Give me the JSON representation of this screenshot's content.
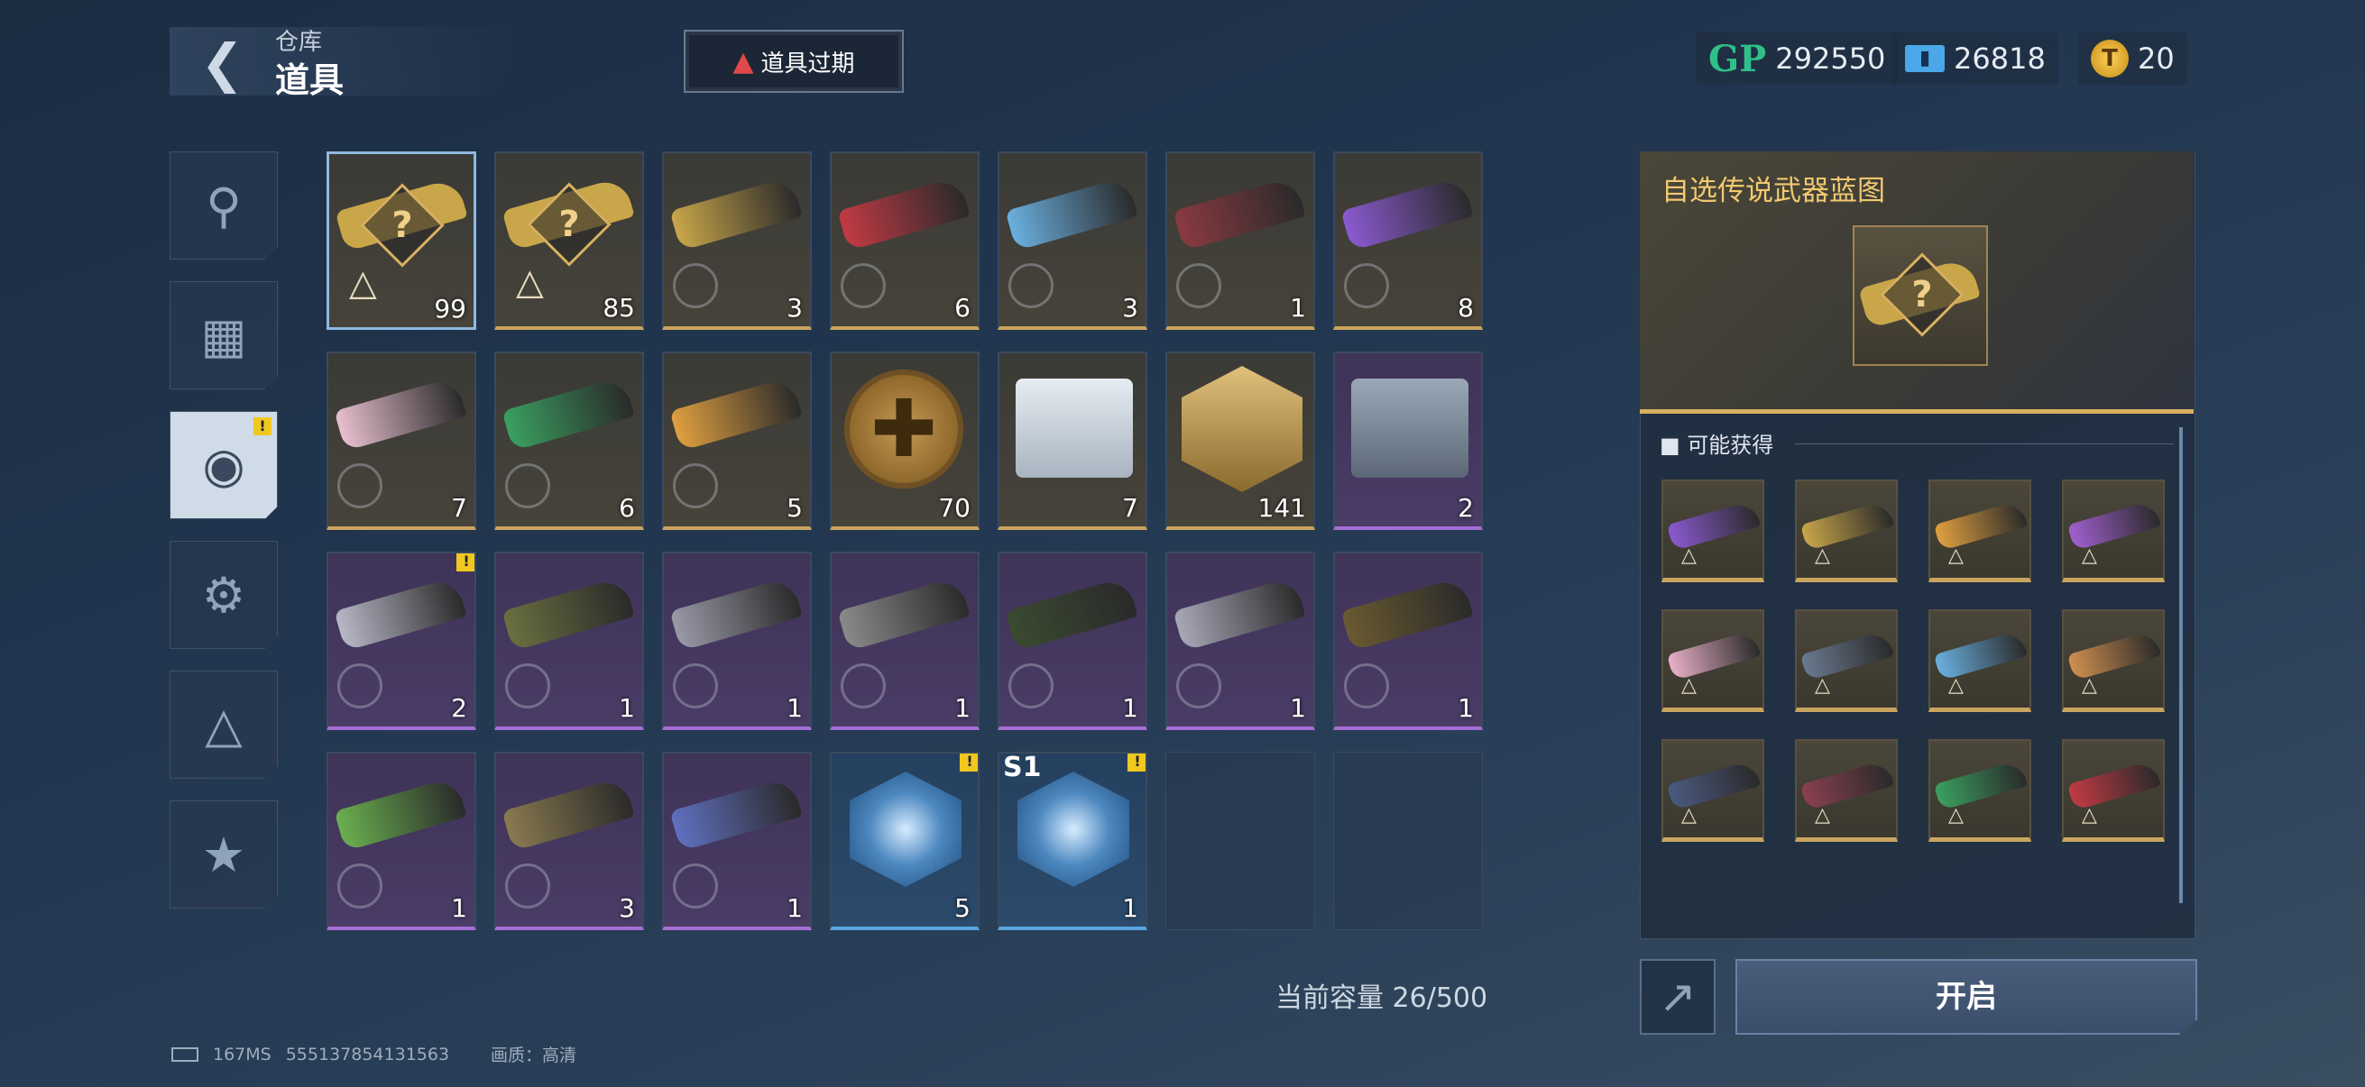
{
  "header": {
    "breadcrumb": "仓库",
    "title": "道具",
    "expired_button": "道具过期"
  },
  "currencies": [
    {
      "icon": "gp-icon",
      "label": "GP",
      "value": "292550"
    },
    {
      "icon": "ticket-icon",
      "value": "26818"
    },
    {
      "icon": "coin-icon",
      "value": "20"
    }
  ],
  "side_tabs": [
    {
      "icon": "pistol-icon"
    },
    {
      "icon": "scroll-icon"
    },
    {
      "icon": "grenade-icon",
      "active": true,
      "badge": "!"
    },
    {
      "icon": "gear-swap-icon"
    },
    {
      "icon": "blueprint-icon"
    },
    {
      "icon": "star-icon"
    }
  ],
  "items": [
    {
      "kind": "blueprint",
      "rarity": "gold",
      "count": "99"
    },
    {
      "kind": "blueprint",
      "rarity": "gold",
      "count": "85"
    },
    {
      "kind": "weapon",
      "rarity": "gold",
      "count": "3",
      "color": "#c9a64a"
    },
    {
      "kind": "weapon",
      "rarity": "gold",
      "count": "6",
      "color": "#c23a44"
    },
    {
      "kind": "weapon",
      "rarity": "gold",
      "count": "3",
      "color": "#6ab0e0"
    },
    {
      "kind": "weapon",
      "rarity": "gold",
      "count": "1",
      "color": "#8a3a40"
    },
    {
      "kind": "weapon",
      "rarity": "gold",
      "count": "8",
      "color": "#8a5ad0"
    },
    {
      "kind": "weapon",
      "rarity": "gold",
      "count": "7",
      "color": "#e8c0d0"
    },
    {
      "kind": "weapon",
      "rarity": "gold",
      "count": "6",
      "color": "#3aa060"
    },
    {
      "kind": "weapon",
      "rarity": "gold",
      "count": "5",
      "color": "#e0a040"
    },
    {
      "kind": "coin",
      "rarity": "gold",
      "count": "70"
    },
    {
      "kind": "crate-silver",
      "rarity": "gold",
      "count": "7"
    },
    {
      "kind": "hex",
      "rarity": "gold",
      "count": "141"
    },
    {
      "kind": "crate",
      "rarity": "purple",
      "count": "2"
    },
    {
      "kind": "weapon",
      "rarity": "purple",
      "count": "2",
      "color": "#b8b8c8",
      "badge": "!"
    },
    {
      "kind": "weapon",
      "rarity": "purple",
      "count": "1",
      "color": "#6a7040"
    },
    {
      "kind": "weapon",
      "rarity": "purple",
      "count": "1",
      "color": "#9a9aa8"
    },
    {
      "kind": "weapon",
      "rarity": "purple",
      "count": "1",
      "color": "#8a8a8a"
    },
    {
      "kind": "weapon",
      "rarity": "purple",
      "count": "1",
      "color": "#3a4a30"
    },
    {
      "kind": "weapon",
      "rarity": "purple",
      "count": "1",
      "color": "#a8a8b8"
    },
    {
      "kind": "weapon",
      "rarity": "purple",
      "count": "1",
      "color": "#6a5a30"
    },
    {
      "kind": "weapon",
      "rarity": "purple",
      "count": "1",
      "color": "#6ab050"
    },
    {
      "kind": "weapon",
      "rarity": "purple",
      "count": "3",
      "color": "#8a7a50"
    },
    {
      "kind": "weapon",
      "rarity": "purple",
      "count": "1",
      "color": "#6070c0"
    },
    {
      "kind": "cube",
      "rarity": "blue",
      "count": "5",
      "badge": "!"
    },
    {
      "kind": "cube",
      "rarity": "blue",
      "count": "1",
      "badge": "!",
      "season": "S1"
    },
    {
      "kind": "empty"
    },
    {
      "kind": "empty"
    }
  ],
  "capacity_text": "当前容量 26/500",
  "detail": {
    "title": "自选传说武器蓝图",
    "obtain_label": "可能获得",
    "rewards": [
      {
        "color": "#8a5ad0"
      },
      {
        "color": "#c9a64a"
      },
      {
        "color": "#e0a040"
      },
      {
        "color": "#a060d0"
      },
      {
        "color": "#e8b0c8"
      },
      {
        "color": "#6a7a90"
      },
      {
        "color": "#6ab0e0"
      },
      {
        "color": "#d09050"
      },
      {
        "color": "#4a5a80"
      },
      {
        "color": "#8a4050"
      },
      {
        "color": "#3aa060"
      },
      {
        "color": "#c23a44"
      }
    ],
    "open_button": "开启"
  },
  "footer": {
    "ping": "167MS",
    "uid": "555137854131563",
    "quality": "画质：高清"
  }
}
